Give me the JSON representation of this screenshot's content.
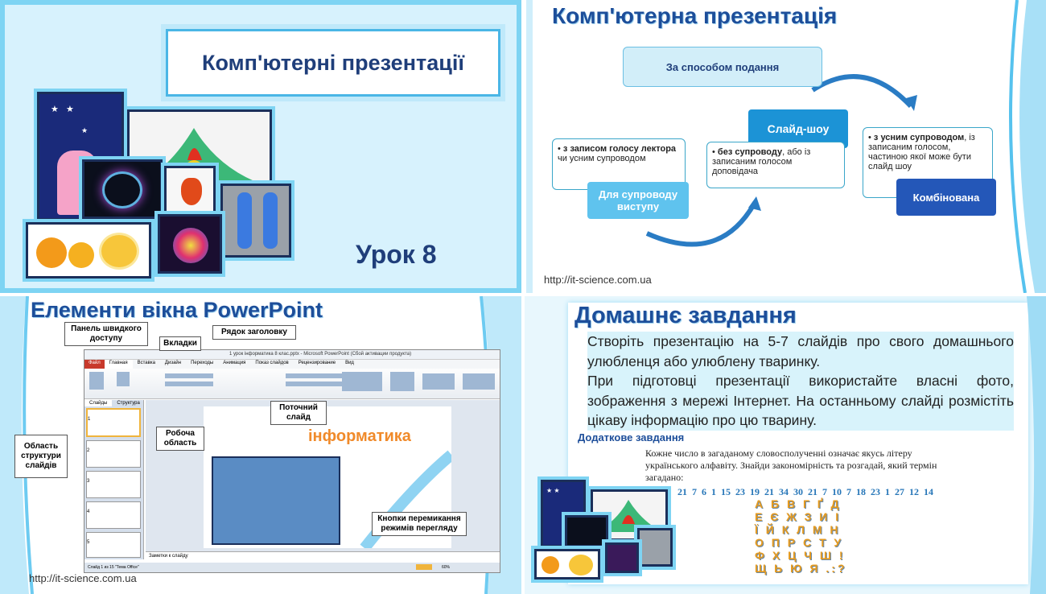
{
  "slide1": {
    "title": "Комп'ютерні презентації",
    "lesson": "Урок 8"
  },
  "slide2": {
    "title": "Комп'ютерна презентація",
    "top_box": "За способом подання",
    "slideshow_btn": "Слайд-шоу",
    "left_bullet_bold": "з записом голосу лектора",
    "left_bullet_rest": " чи усним супроводом",
    "left_btn": "Для супроводу виступу",
    "mid_bullet_bold": "без супроводу",
    "mid_bullet_rest": ", або із записаним голосом доповідача",
    "right_bullet_bold": "з усним супроводом",
    "right_bullet_rest": ", із записаним голосом, частиною якої може бути слайд шоу",
    "right_btn": "Комбінована",
    "url": "http://it-science.com.ua"
  },
  "slide3": {
    "title": "Елементи вікна PowerPoint",
    "callouts": {
      "quick_access": "Панель швидкого доступу",
      "tabs": "Вкладки",
      "title_bar": "Рядок заголовку",
      "current_slide": "Поточний слайд",
      "work_area": "Робоча область",
      "slide_structure": "Область структури слайдів",
      "view_buttons": "Кнопки перемикання режимів перегляду"
    },
    "window_title": "1 урок інформатика 8 клас.pptx - Microsoft PowerPoint (Сбой активации продукта)",
    "ribbon_tabs": [
      "Файл",
      "Главная",
      "Вставка",
      "Дизайн",
      "Переходы",
      "Анимация",
      "Показ слайдов",
      "Рецензирование",
      "Вид"
    ],
    "panel_tabs": [
      "Слайды",
      "Структура"
    ],
    "slide_word": "інформатика",
    "notes": "Заметки к слайду",
    "status": "Слайд 1 из 15   \"Тема Office\"",
    "zoom": "60%",
    "thumb_numbers": [
      "1",
      "2",
      "3",
      "4",
      "5"
    ],
    "url": "http://it-science.com.ua"
  },
  "slide4": {
    "title": "Домашнє завдання",
    "p1": "Створіть презентацію на 5-7 слайдів про свого домашнього улюбленця або улюблену тваринку.",
    "p2": "При підготовці презентації використайте власні фото, зображення з мережі Інтернет. На останньому слайді розмістіть цікаву інформацію про цю тварину.",
    "extra_title": "Додаткове завдання",
    "riddle": "Кожне число в загаданому словосполученні означає якусь літеру українського алфавіту. Знайди закономірність та розгадай, який термін загадано:",
    "numbers": "21 7 6 1 15 23 19 21 34 30 21 7 10 7 18 23 1 27 12 14",
    "alphabet": [
      "А Б В Г Ґ Д",
      "Е Є Ж З И І",
      "Ї Й К Л М Н",
      "О П Р С Т У",
      "Ф Х Ц Ч Ш !",
      "Щ Ь Ю Я .:?"
    ]
  },
  "colors": {
    "accent": "#1d4e9a",
    "frame": "#7ed4f3",
    "button_light": "#5fc3ee",
    "button_dark": "#2457b8"
  }
}
